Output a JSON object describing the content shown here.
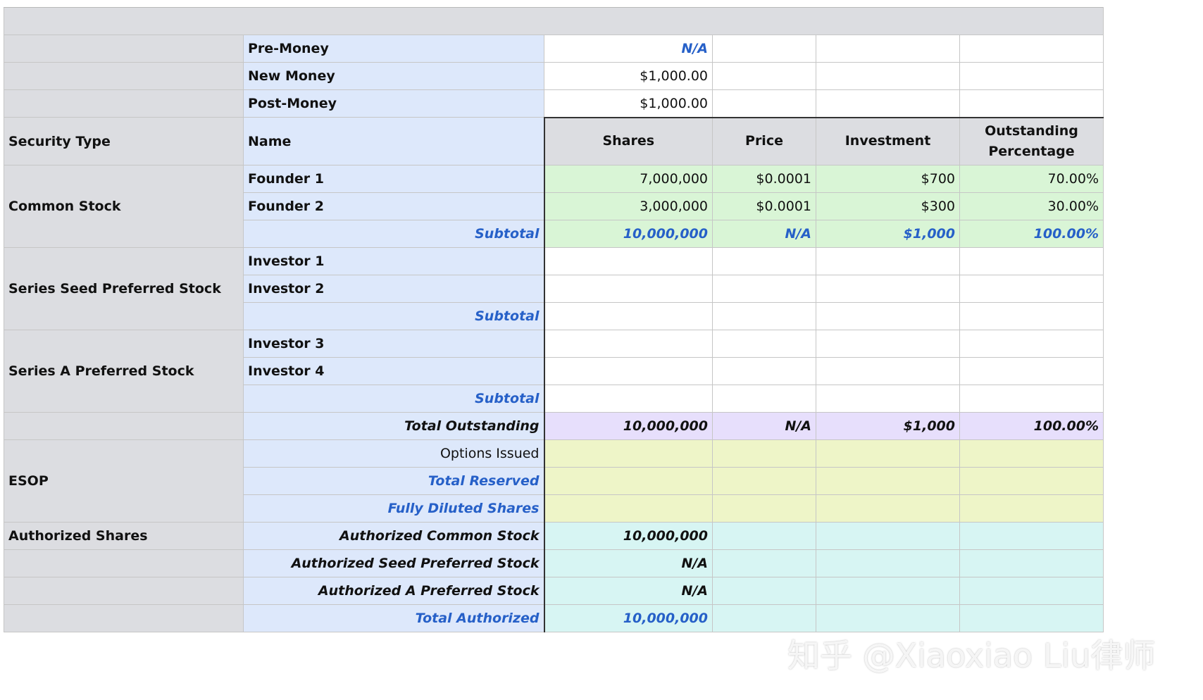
{
  "valuation": [
    {
      "label": "Pre-Money",
      "value": "N/A"
    },
    {
      "label": "New Money",
      "value": "$1,000.00"
    },
    {
      "label": "Post-Money",
      "value": "$1,000.00"
    }
  ],
  "header": {
    "security_type": "Security Type",
    "name": "Name",
    "shares": "Shares",
    "price": "Price",
    "investment": "Investment",
    "outstanding_pct": "Outstanding Percentage"
  },
  "common_stock": {
    "label": "Common Stock",
    "rows": [
      {
        "name": "Founder 1",
        "shares": "7,000,000",
        "price": "$0.0001",
        "investment": "$700",
        "pct": "70.00%"
      },
      {
        "name": "Founder 2",
        "shares": "3,000,000",
        "price": "$0.0001",
        "investment": "$300",
        "pct": "30.00%"
      }
    ],
    "subtotal": {
      "label": "Subtotal",
      "shares": "10,000,000",
      "price": "N/A",
      "investment": "$1,000",
      "pct": "100.00%"
    }
  },
  "series_seed": {
    "label": "Series Seed Preferred Stock",
    "rows": [
      {
        "name": "Investor 1"
      },
      {
        "name": "Investor 2"
      }
    ],
    "subtotal_label": "Subtotal"
  },
  "series_a": {
    "label": "Series A Preferred Stock",
    "rows": [
      {
        "name": "Investor 3"
      },
      {
        "name": "Investor 4"
      }
    ],
    "subtotal_label": "Subtotal"
  },
  "total_outstanding": {
    "label": "Total Outstanding",
    "shares": "10,000,000",
    "price": "N/A",
    "investment": "$1,000",
    "pct": "100.00%"
  },
  "esop": {
    "label": "ESOP",
    "options_issued": "Options Issued",
    "total_reserved": "Total Reserved",
    "fully_diluted": "Fully Diluted Shares"
  },
  "authorized": {
    "label": "Authorized Shares",
    "common": {
      "label": "Authorized Common Stock",
      "value": "10,000,000"
    },
    "seed": {
      "label": "Authorized Seed Preferred Stock",
      "value": "N/A"
    },
    "series_a": {
      "label": "Authorized A Preferred Stock",
      "value": "N/A"
    },
    "total": {
      "label": "Total Authorized",
      "value": "10,000,000"
    }
  },
  "watermark": "知乎 @Xiaoxiao Liu律师"
}
